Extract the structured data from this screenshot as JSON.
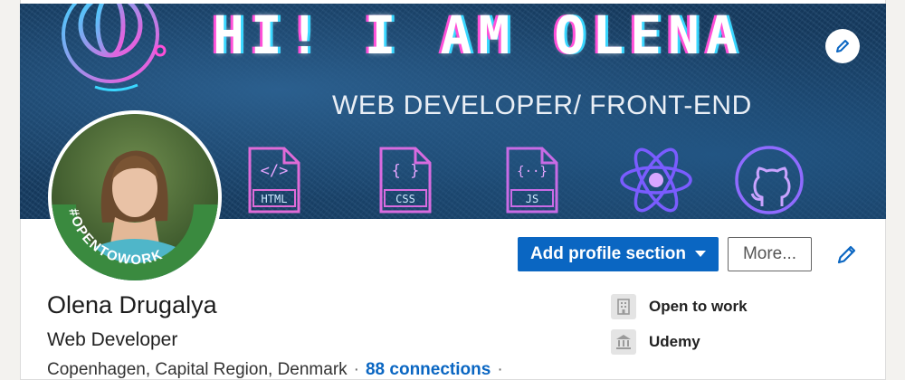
{
  "banner": {
    "heading": "HI! I AM OLENA",
    "subheading": "WEB DEVELOPER/ FRONT-END",
    "tech_icons": [
      {
        "label": "HTML",
        "glyph": "</>",
        "icon": "html-file-icon"
      },
      {
        "label": "CSS",
        "glyph": "{ }",
        "icon": "css-file-icon"
      },
      {
        "label": "JS",
        "glyph": "{··}",
        "icon": "js-file-icon"
      }
    ],
    "colors": {
      "background": "#173f66",
      "neon_pink": "#ff4fd8",
      "neon_cyan": "#3ad7ff",
      "violet": "#7a5cff"
    }
  },
  "avatar": {
    "frame_text": "#OPENTOWORK",
    "frame_color": "#2f7d3c"
  },
  "actions": {
    "add_profile_section_label": "Add profile section",
    "more_label": "More...",
    "accent": "#0a66c2"
  },
  "profile": {
    "name": "Olena Drugalya",
    "headline": "Web Developer",
    "location": "Copenhagen, Capital Region, Denmark",
    "connections": "88 connections",
    "separator": "·"
  },
  "side_panel": [
    {
      "label": "Open to work",
      "icon": "building-icon"
    },
    {
      "label": "Udemy",
      "icon": "institution-icon"
    }
  ]
}
